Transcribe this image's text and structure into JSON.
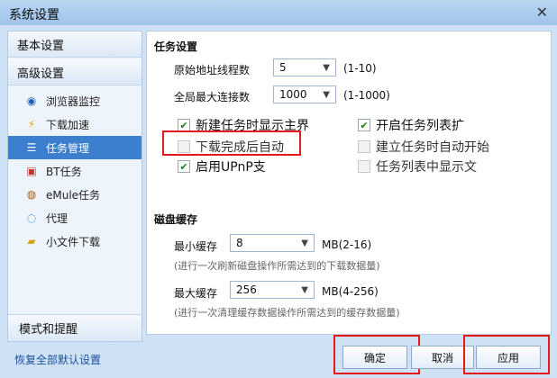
{
  "window": {
    "title": "系统设置",
    "close_icon": "close-icon"
  },
  "sidebar": {
    "basic": "基本设置",
    "advanced": "高级设置",
    "items": [
      {
        "label": "浏览器监控",
        "icon": "globe-icon"
      },
      {
        "label": "下载加速",
        "icon": "lightning-icon"
      },
      {
        "label": "任务管理",
        "icon": "task-icon"
      },
      {
        "label": "BT任务",
        "icon": "bt-icon"
      },
      {
        "label": "eMule任务",
        "icon": "emule-icon"
      },
      {
        "label": "代理",
        "icon": "proxy-icon"
      },
      {
        "label": "小文件下载",
        "icon": "folder-icon"
      }
    ],
    "footer": "模式和提醒"
  },
  "task": {
    "title": "任务设置",
    "threads_label": "原始地址线程数",
    "threads_value": "5",
    "threads_range": "(1-10)",
    "conn_label": "全局最大连接数",
    "conn_value": "1000",
    "conn_range": "(1-1000)",
    "opt1": "新建任务时显示主界",
    "opt2": "开启任务列表扩",
    "opt3": "下载完成后自动",
    "opt4": "建立任务时自动开始",
    "opt5": "启用UPnP支",
    "opt6": "任务列表中显示文"
  },
  "disk": {
    "title": "磁盘缓存",
    "min_label": "最小缓存",
    "min_value": "8",
    "min_unit": "MB(2-16)",
    "min_hint": "(进行一次刷新磁盘操作所需达到的下载数据量)",
    "max_label": "最大缓存",
    "max_value": "256",
    "max_unit": "MB(4-256)",
    "max_hint": "(进行一次清理缓存数据操作所需达到的缓存数据量)"
  },
  "footer": {
    "restore": "恢复全部默认设置",
    "ok": "确定",
    "cancel": "取消",
    "apply": "应用"
  }
}
